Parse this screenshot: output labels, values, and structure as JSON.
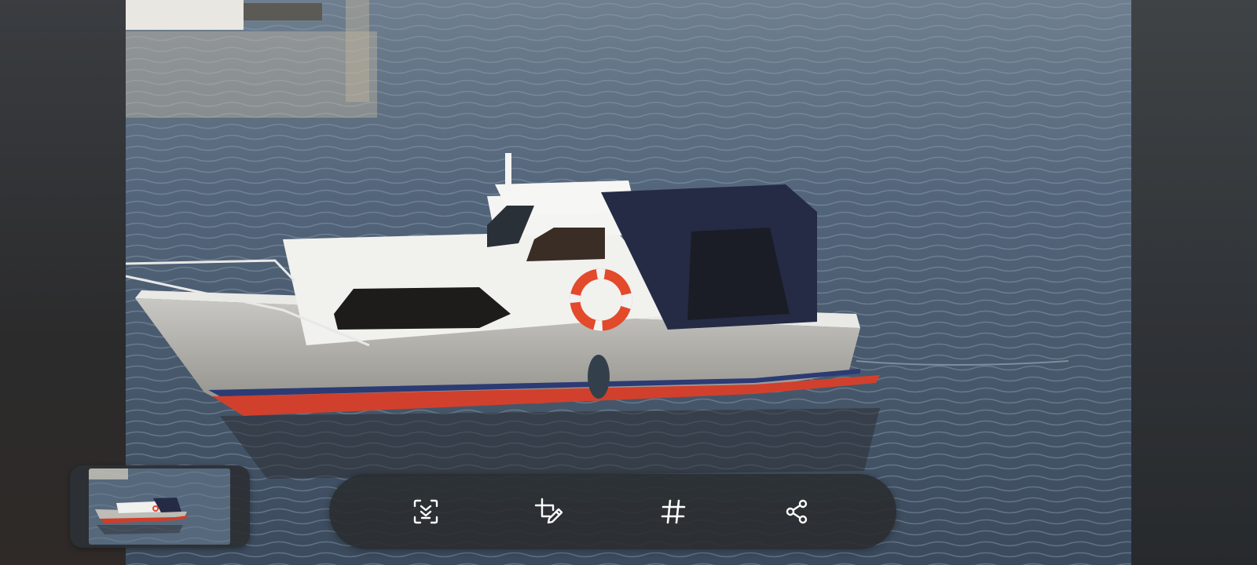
{
  "viewer": {
    "image_subject": "boat-photo"
  },
  "thumbnail": {
    "selected": true
  },
  "toolbar": {
    "actions": [
      {
        "id": "smart-select",
        "icon": "smart-select-icon"
      },
      {
        "id": "edit",
        "icon": "crop-edit-icon"
      },
      {
        "id": "tag",
        "icon": "hashtag-icon"
      },
      {
        "id": "share",
        "icon": "share-icon"
      }
    ]
  },
  "colors": {
    "toolbar_bg": "#2a2d31",
    "icon": "#ffffff",
    "water": "#596a7d",
    "hull": "#a8a7a2",
    "canopy": "#252b45",
    "lifebuoy": "#e24a2b"
  }
}
